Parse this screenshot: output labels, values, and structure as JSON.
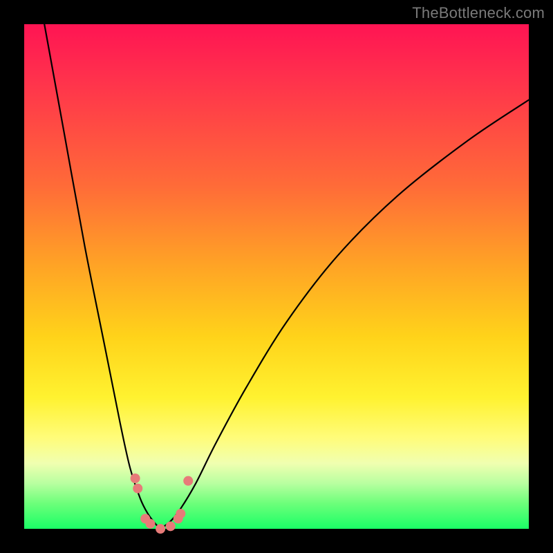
{
  "watermark": "TheBottleneck.com",
  "colors": {
    "frame": "#000000",
    "gradient_top": "#ff1453",
    "gradient_mid": "#ffd31a",
    "gradient_bottom": "#1aff66",
    "curve": "#000000",
    "marker": "#e77b79"
  },
  "chart_data": {
    "type": "line",
    "title": "",
    "xlabel": "",
    "ylabel": "",
    "xlim": [
      0,
      100
    ],
    "ylim": [
      0,
      100
    ],
    "grid": false,
    "notes": "Bottleneck V-curve: y≈0 at optimum (~x≈27), rises steeply toward both sides. Background gradient encodes severity (green=good, red=bad). Marker points cluster near the minimum.",
    "series": [
      {
        "name": "left-branch",
        "x": [
          4,
          8,
          12,
          16,
          19,
          21,
          23,
          24.5,
          26,
          27
        ],
        "y": [
          100,
          78,
          56,
          36,
          21,
          12,
          6,
          3,
          1,
          0
        ]
      },
      {
        "name": "right-branch",
        "x": [
          27,
          29,
          31,
          34,
          38,
          44,
          52,
          62,
          74,
          88,
          100
        ],
        "y": [
          0,
          1.5,
          4,
          9,
          17,
          28,
          41,
          54,
          66,
          77,
          85
        ]
      }
    ],
    "markers": [
      {
        "x": 22.0,
        "y": 10.0
      },
      {
        "x": 22.5,
        "y": 8.0
      },
      {
        "x": 24.0,
        "y": 2.0
      },
      {
        "x": 25.0,
        "y": 1.0
      },
      {
        "x": 27.0,
        "y": 0.0
      },
      {
        "x": 29.0,
        "y": 0.5
      },
      {
        "x": 30.5,
        "y": 2.0
      },
      {
        "x": 31.0,
        "y": 3.0
      },
      {
        "x": 32.5,
        "y": 9.5
      }
    ]
  }
}
